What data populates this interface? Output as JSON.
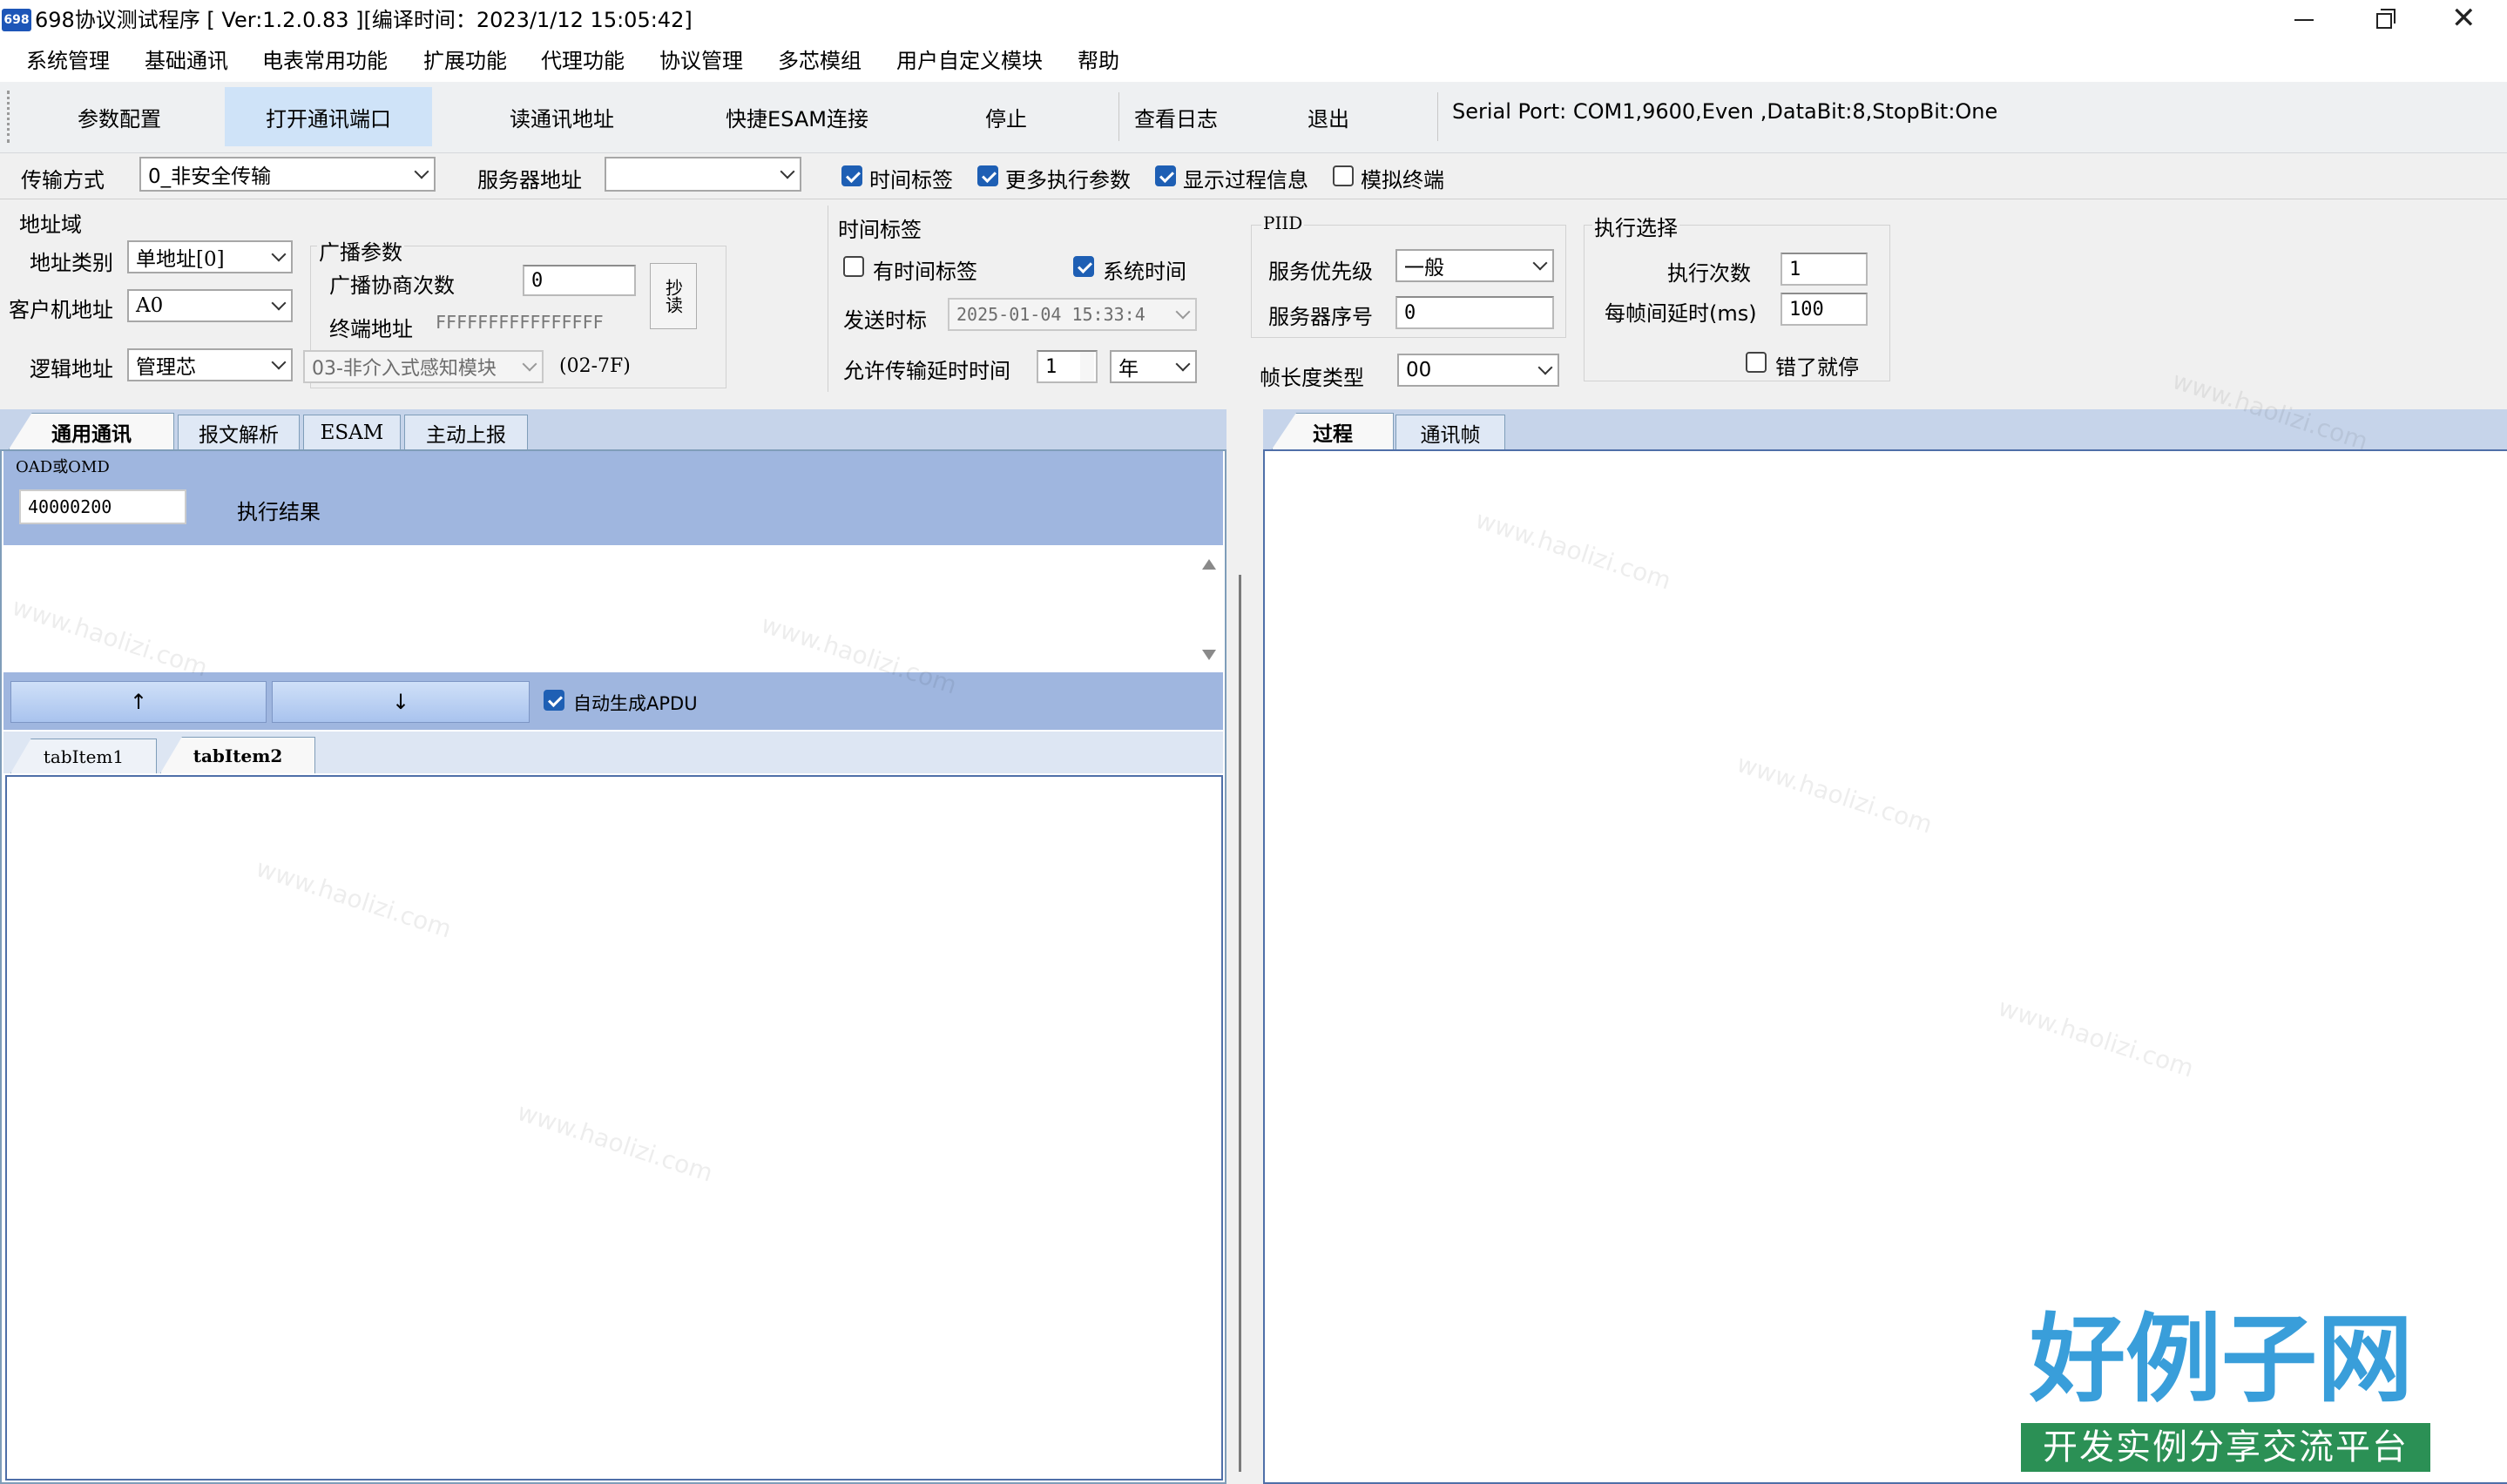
{
  "window": {
    "app_icon_text": "698",
    "title": "698协议测试程序 [ Ver:1.2.0.83 ][编译时间：2023/1/12 15:05:42]"
  },
  "menu": [
    "系统管理",
    "基础通讯",
    "电表常用功能",
    "扩展功能",
    "代理功能",
    "协议管理",
    "多芯模组",
    "用户自定义模块",
    "帮助"
  ],
  "toolbar": {
    "buttons": [
      "参数配置",
      "打开通讯端口",
      "读通讯地址",
      "快捷ESAM连接",
      "停止",
      "查看日志",
      "退出"
    ],
    "serial_port": "Serial Port:  COM1,9600,Even ,DataBit:8,StopBit:One"
  },
  "options_row": {
    "transfer_label": "传输方式",
    "transfer_value": "0_非安全传输",
    "server_label": "服务器地址",
    "server_value": "",
    "checkboxes": [
      {
        "label": "时间标签",
        "checked": true
      },
      {
        "label": "更多执行参数",
        "checked": true
      },
      {
        "label": "显示过程信息",
        "checked": true
      },
      {
        "label": "模拟终端",
        "checked": false
      }
    ]
  },
  "address": {
    "title": "地址域",
    "type_label": "地址类别",
    "type_value": "单地址[0]",
    "client_label": "客户机地址",
    "client_value": "A0",
    "logic_label": "逻辑地址",
    "logic_value": "管理芯"
  },
  "broadcast": {
    "title": "广播参数",
    "negotiation_label": "广播协商次数",
    "negotiation_value": "0",
    "terminal_label": "终端地址",
    "terminal_value": "FFFFFFFFFFFFFFFF",
    "read_button": "抄读",
    "module_value": "03-非介入式感知模块",
    "range": "(02-7F)"
  },
  "time_tag": {
    "title": "时间标签",
    "has_tag_label": "有时间标签",
    "has_tag_checked": false,
    "system_time_label": "系统时间",
    "system_time_checked": true,
    "send_label": "发送时标",
    "send_value": "2025-01-04 15:33:4",
    "delay_label": "允许传输延时时间",
    "delay_value": "1",
    "delay_unit": "年"
  },
  "piid": {
    "title": "PIID",
    "priority_label": "服务优先级",
    "priority_value": "一般",
    "serial_label": "服务器序号",
    "serial_value": "0",
    "frame_len_label": "帧长度类型",
    "frame_len_value": "00"
  },
  "exec": {
    "title": "执行选择",
    "count_label": "执行次数",
    "count_value": "1",
    "delay_label": "每帧间延时(ms)",
    "delay_value": "100",
    "stop_on_error_label": "错了就停",
    "stop_on_error_checked": false
  },
  "left_tabs": [
    "通用通讯",
    "报文解析",
    "ESAM",
    "主动上报"
  ],
  "oad": {
    "label": "OAD或OMD",
    "value": "40000200",
    "result_label": "执行结果"
  },
  "arrows": {
    "up": "↑",
    "down": "↓"
  },
  "auto_apdu": {
    "label": "自动生成APDU",
    "checked": true
  },
  "sub_tabs": [
    "tabItem1",
    "tabItem2"
  ],
  "right_tabs": [
    "过程",
    "通讯帧"
  ],
  "watermark": {
    "text": "www.haolizi.com",
    "logo_main": "好例子网",
    "logo_sub": "开发实例分享交流平台"
  }
}
